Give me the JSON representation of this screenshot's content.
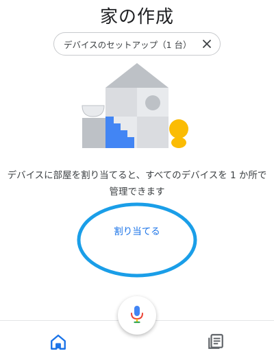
{
  "header": {
    "title": "家の作成"
  },
  "chip": {
    "label": "デバイスのセットアップ（1 台）",
    "close_icon": "close-icon"
  },
  "illustration": {
    "icon": "home-rooms-illustration"
  },
  "main": {
    "description": "デバイスに部屋を割り当てると、すべてのデバイスを 1 か所で管理できます",
    "assign_label": "割り当てる"
  },
  "annotation": {
    "highlight_color": "#1a9ee8"
  },
  "bottom_nav": {
    "home_icon": "home-icon",
    "feed_icon": "feed-icon"
  },
  "mic": {
    "icon": "mic-icon"
  },
  "colors": {
    "accent": "#1a73e8",
    "yellow": "#fbbc04",
    "red": "#ea4335"
  }
}
